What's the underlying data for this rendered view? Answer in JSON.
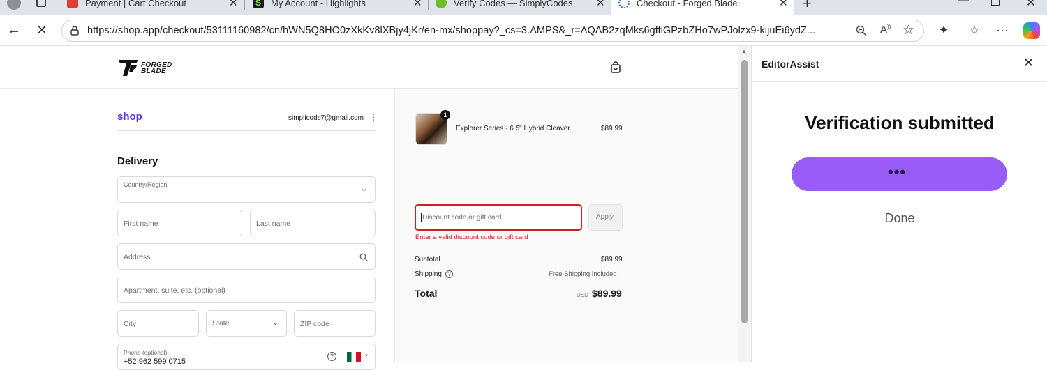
{
  "browser": {
    "tabs": [
      {
        "title": "Payment | Cart Checkout",
        "favicon_color": "#e23b3b"
      },
      {
        "title": "My Account - Highlights",
        "favicon_color": "#1f7a1f"
      },
      {
        "title": "Verify Codes — SimplyCodes",
        "favicon_color": "#6cbf2a"
      },
      {
        "title": "Checkout - Forged Blade",
        "favicon_color": "#2f6fe0"
      }
    ],
    "url": "https://shop.app/checkout/53111160982/cn/hWN5Q8HO0zXkKv8lXBjy4jKr/en-mx/shoppay?_cs=3.AMPS&_r=AQAB2zqMks6gffiGPzbZHo7wPJolzx9-kijuEi6ydZ..."
  },
  "site": {
    "logo_line1": "FORGED",
    "logo_line2": "BLADE"
  },
  "account": {
    "shop_label": "shop",
    "email": "simplicods7@gmail.com"
  },
  "delivery": {
    "heading": "Delivery",
    "country_label": "Country/Region",
    "first_name_placeholder": "First name",
    "last_name_placeholder": "Last name",
    "address_placeholder": "Address",
    "apartment_placeholder": "Apartment, suite, etc. (optional)",
    "city_placeholder": "City",
    "state_label": "State",
    "zip_placeholder": "ZIP code",
    "phone_label": "Phone (optional)",
    "phone_value": "+52 962 599 0715"
  },
  "summary": {
    "item_qty": "1",
    "item_name": "Explorer Series - 6.5\" Hybrid Cleaver",
    "item_price": "$89.99",
    "discount_placeholder": "Discount code or gift card",
    "apply_label": "Apply",
    "discount_error": "Enter a valid discount code or gift card",
    "subtotal_label": "Subtotal",
    "subtotal_value": "$89.99",
    "shipping_label": "Shipping",
    "shipping_value": "Free Shipping Included",
    "total_label": "Total",
    "total_currency": "USD",
    "total_value": "$89.99"
  },
  "panel": {
    "title": "EditorAssist",
    "heading": "Verification submitted",
    "done_label": "Done"
  },
  "colors": {
    "shop_purple": "#5a31f4",
    "panel_button": "#9a5cf7",
    "error_red": "#d61d1d"
  }
}
